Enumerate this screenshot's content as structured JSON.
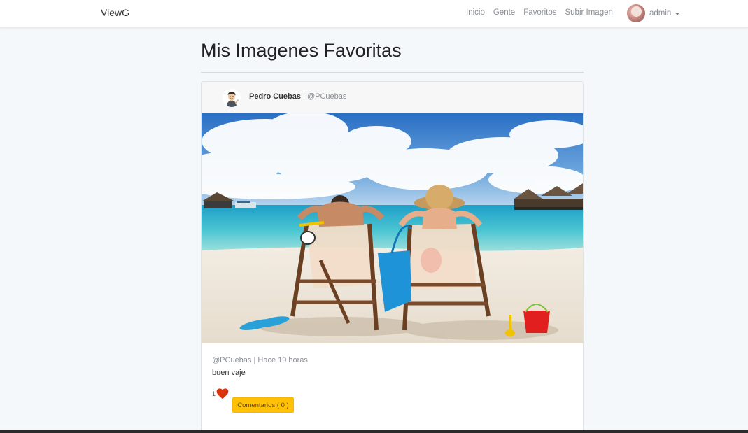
{
  "navbar": {
    "brand": "ViewG",
    "links": [
      "Inicio",
      "Gente",
      "Favoritos",
      "Subir Imagen"
    ],
    "user": "admin"
  },
  "page": {
    "title": "Mis Imagenes Favoritas"
  },
  "post": {
    "author_name": "Pedro Cuebas",
    "author_separator": " | ",
    "author_handle": "@PCuebas",
    "meta": "@PCuebas | Hace 19 horas",
    "description": "buen vaje",
    "likes": "1",
    "comments_label": "Comentarios ( 0 )",
    "heart_color": "#d9340f"
  }
}
